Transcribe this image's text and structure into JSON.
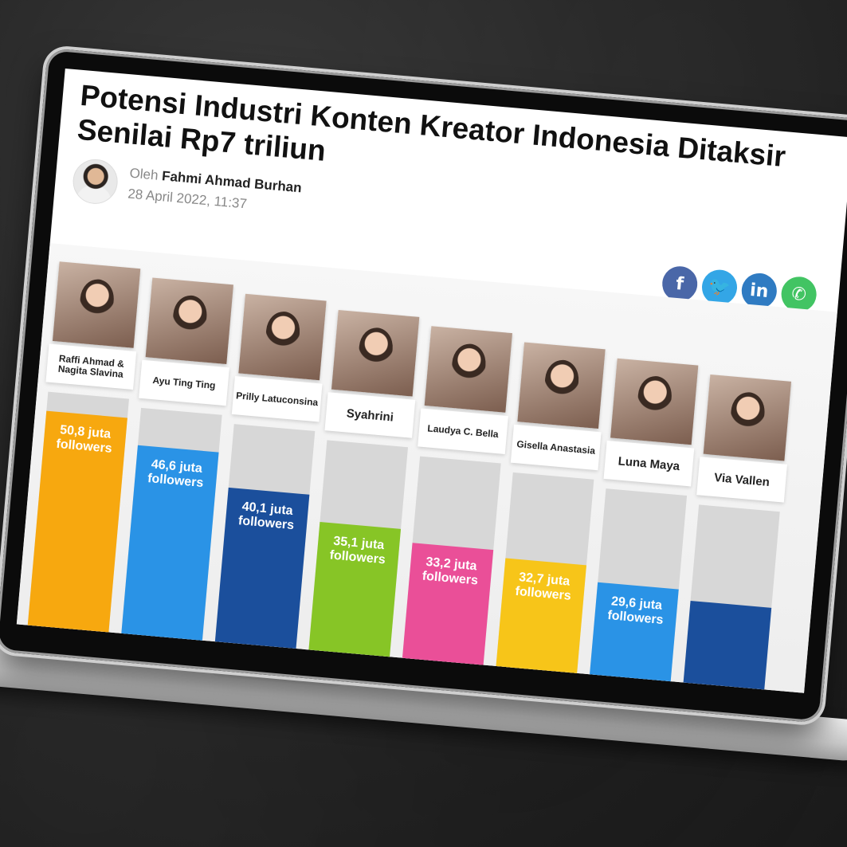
{
  "article": {
    "title": "Potensi Industri Konten Kreator Indonesia Ditaksir Senilai Rp7 triliun",
    "byline_prefix": "Oleh",
    "author": "Fahmi Ahmad Burhan",
    "date": "28 April 2022, 11:37"
  },
  "share": {
    "facebook_icon": "f",
    "twitter_icon": "🐦",
    "linkedin_icon": "in",
    "whatsapp_icon": "✆"
  },
  "chart_data": {
    "type": "bar",
    "categories": [
      "Raffi Ahmad & Nagita Slavina",
      "Ayu Ting Ting",
      "Prilly Latuconsina",
      "Syahrini",
      "Laudya C. Bella",
      "Gisella Anastasia",
      "Luna Maya",
      "Via Vallen"
    ],
    "value_labels": [
      "50,8 juta followers",
      "46,6 juta followers",
      "40,1 juta followers",
      "35,1 juta followers",
      "33,2 juta followers",
      "32,7 juta followers",
      "29,6 juta followers",
      ""
    ],
    "values": [
      50.8,
      46.6,
      40.1,
      35.1,
      33.2,
      32.7,
      29.6,
      28.0
    ],
    "unit": "juta followers",
    "colors": [
      "#f7a80f",
      "#2a93e6",
      "#1b4f9c",
      "#87c526",
      "#ea4f98",
      "#f7c519",
      "#2a93e6",
      "#1b4f9c"
    ]
  }
}
